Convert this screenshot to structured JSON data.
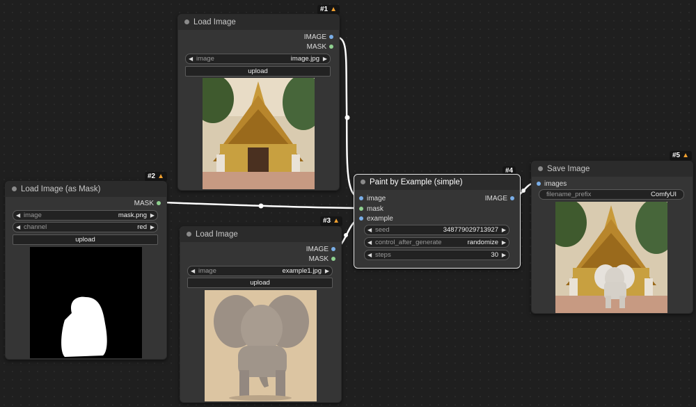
{
  "nodes": {
    "n1": {
      "badge": "#1",
      "title": "Load Image",
      "outputs": [
        "IMAGE",
        "MASK"
      ],
      "image_widget": {
        "label": "image",
        "value": "image.jpg"
      },
      "upload": "upload"
    },
    "n2": {
      "badge": "#2",
      "title": "Load Image (as Mask)",
      "outputs": [
        "MASK"
      ],
      "image_widget": {
        "label": "image",
        "value": "mask.png"
      },
      "channel_widget": {
        "label": "channel",
        "value": "red"
      },
      "upload": "upload"
    },
    "n3": {
      "badge": "#3",
      "title": "Load Image",
      "outputs": [
        "IMAGE",
        "MASK"
      ],
      "image_widget": {
        "label": "image",
        "value": "example1.jpg"
      },
      "upload": "upload"
    },
    "n4": {
      "badge": "#4",
      "title": "Paint by Example (simple)",
      "inputs": [
        "image",
        "mask",
        "example"
      ],
      "outputs": [
        "IMAGE"
      ],
      "seed": {
        "label": "seed",
        "value": "348779029713927"
      },
      "control": {
        "label": "control_after_generate",
        "value": "randomize"
      },
      "steps": {
        "label": "steps",
        "value": "30"
      }
    },
    "n5": {
      "badge": "#5",
      "title": "Save Image",
      "inputs": [
        "images"
      ],
      "prefix": {
        "label": "filename_prefix",
        "value": "ComfyUI"
      }
    }
  },
  "icons": {
    "badge_icon": "fox-icon",
    "left": "◀",
    "right": "▶"
  },
  "colors": {
    "image_pin": "#7aaee8",
    "mask_pin": "#8fd08f",
    "link": "#ffffff",
    "canvas": "#1f1f1f"
  }
}
